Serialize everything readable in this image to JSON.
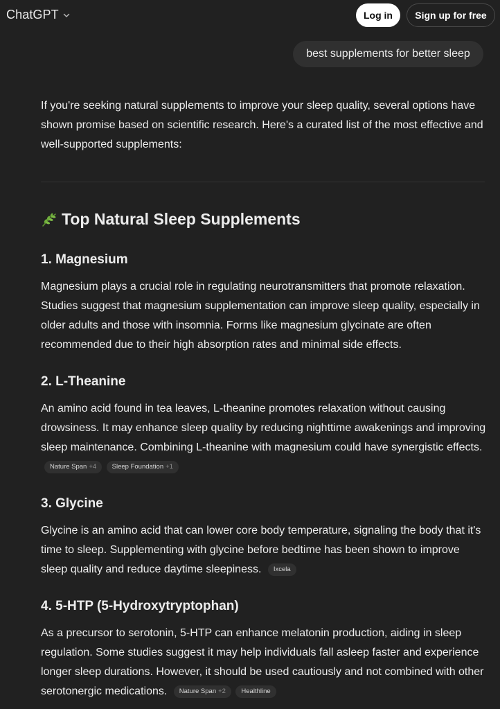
{
  "header": {
    "app_name": "ChatGPT",
    "login_label": "Log in",
    "signup_label": "Sign up for free"
  },
  "user_message": "best supplements for better sleep",
  "intro": "If you're seeking natural supplements to improve your sleep quality, several options have shown promise based on scientific research. Here's a curated list of the most effective and well-supported supplements:",
  "main_heading": {
    "icon": "herb-emoji",
    "text": "Top Natural Sleep Supplements"
  },
  "sections": [
    {
      "title": "1. Magnesium",
      "body": "Magnesium plays a crucial role in regulating neurotransmitters that promote relaxation. Studies suggest that magnesium supplementation can improve sleep quality, especially in older adults and those with insomnia. Forms like magnesium glycinate are often recommended due to their high absorption rates and minimal side effects."
    },
    {
      "title": "2. L-Theanine",
      "body": "An amino acid found in tea leaves, L-theanine promotes relaxation without causing drowsiness. It may enhance sleep quality by reducing nighttime awakenings and improving sleep maintenance. Combining L-theanine with magnesium could have synergistic effects.",
      "citations": [
        {
          "source": "Nature Span",
          "extra": "+4"
        },
        {
          "source": "Sleep Foundation",
          "extra": "+1"
        }
      ]
    },
    {
      "title": "3. Glycine",
      "body": "Glycine is an amino acid that can lower core body temperature, signaling the body that it's time to sleep. Supplementing with glycine before bedtime has been shown to improve sleep quality and reduce daytime sleepiness.",
      "citations": [
        {
          "source": "Ixcela"
        }
      ]
    },
    {
      "title": "4. 5-HTP (5-Hydroxytryptophan)",
      "body": "As a precursor to serotonin, 5-HTP can enhance melatonin production, aiding in sleep regulation. Some studies suggest it may help individuals fall asleep faster and experience longer sleep durations. However, it should be used cautiously and not combined with other serotonergic medications.",
      "citations": [
        {
          "source": "Nature Span",
          "extra": "+2"
        },
        {
          "source": "Healthline"
        }
      ]
    }
  ]
}
